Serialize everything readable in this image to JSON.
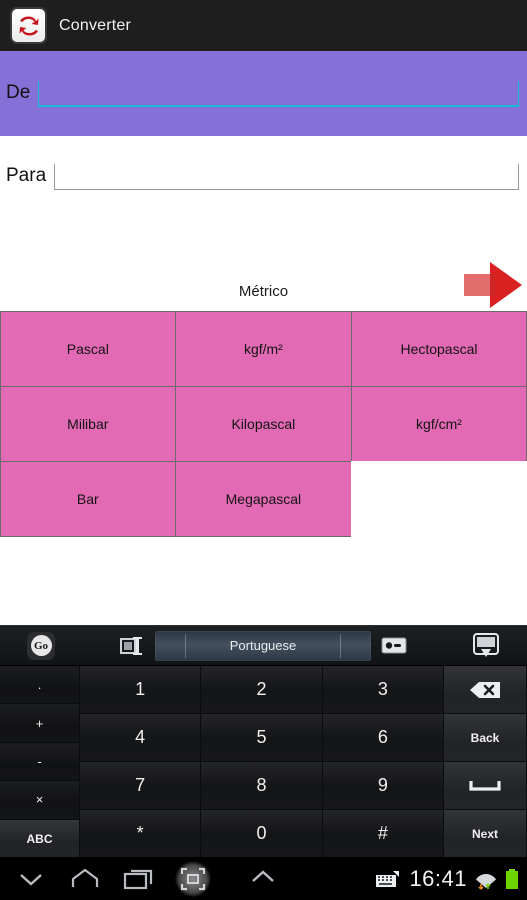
{
  "actionbar": {
    "title": "Converter",
    "icon": "app-convert-arrows-icon"
  },
  "from_field": {
    "label": "De",
    "value": "",
    "placeholder": ""
  },
  "to_field": {
    "label": "Para",
    "value": "",
    "placeholder": ""
  },
  "next_arrow_label": "next-arrow",
  "category": {
    "title": "Métrico"
  },
  "units": [
    {
      "label": "Pascal"
    },
    {
      "label": "kgf/m²"
    },
    {
      "label": "Hectopascal"
    },
    {
      "label": "Milibar"
    },
    {
      "label": "Kilopascal"
    },
    {
      "label": "kgf/cm²"
    },
    {
      "label": "Bar"
    },
    {
      "label": "Megapascal"
    },
    {
      "label": ""
    }
  ],
  "keyboard": {
    "toolbar": {
      "logo_text": "Go",
      "language": "Portuguese"
    },
    "left_column": [
      ".",
      "+",
      "-",
      "×",
      "ABC"
    ],
    "numpad": [
      [
        "1",
        "2",
        "3"
      ],
      [
        "4",
        "5",
        "6"
      ],
      [
        "7",
        "8",
        "9"
      ],
      [
        "*",
        "0",
        "#"
      ]
    ],
    "right_column": [
      "",
      "Back",
      "",
      "Next"
    ],
    "right_column_icons": [
      "backspace-icon",
      "",
      "space-icon",
      ""
    ]
  },
  "statusbar": {
    "time": "16:41"
  },
  "colors": {
    "accent_purple": "#8570d8",
    "unit_pink": "#e269b3",
    "focus_cyan": "#19bcd6",
    "arrow_red": "#d92121",
    "battery_green": "#6dd400"
  }
}
